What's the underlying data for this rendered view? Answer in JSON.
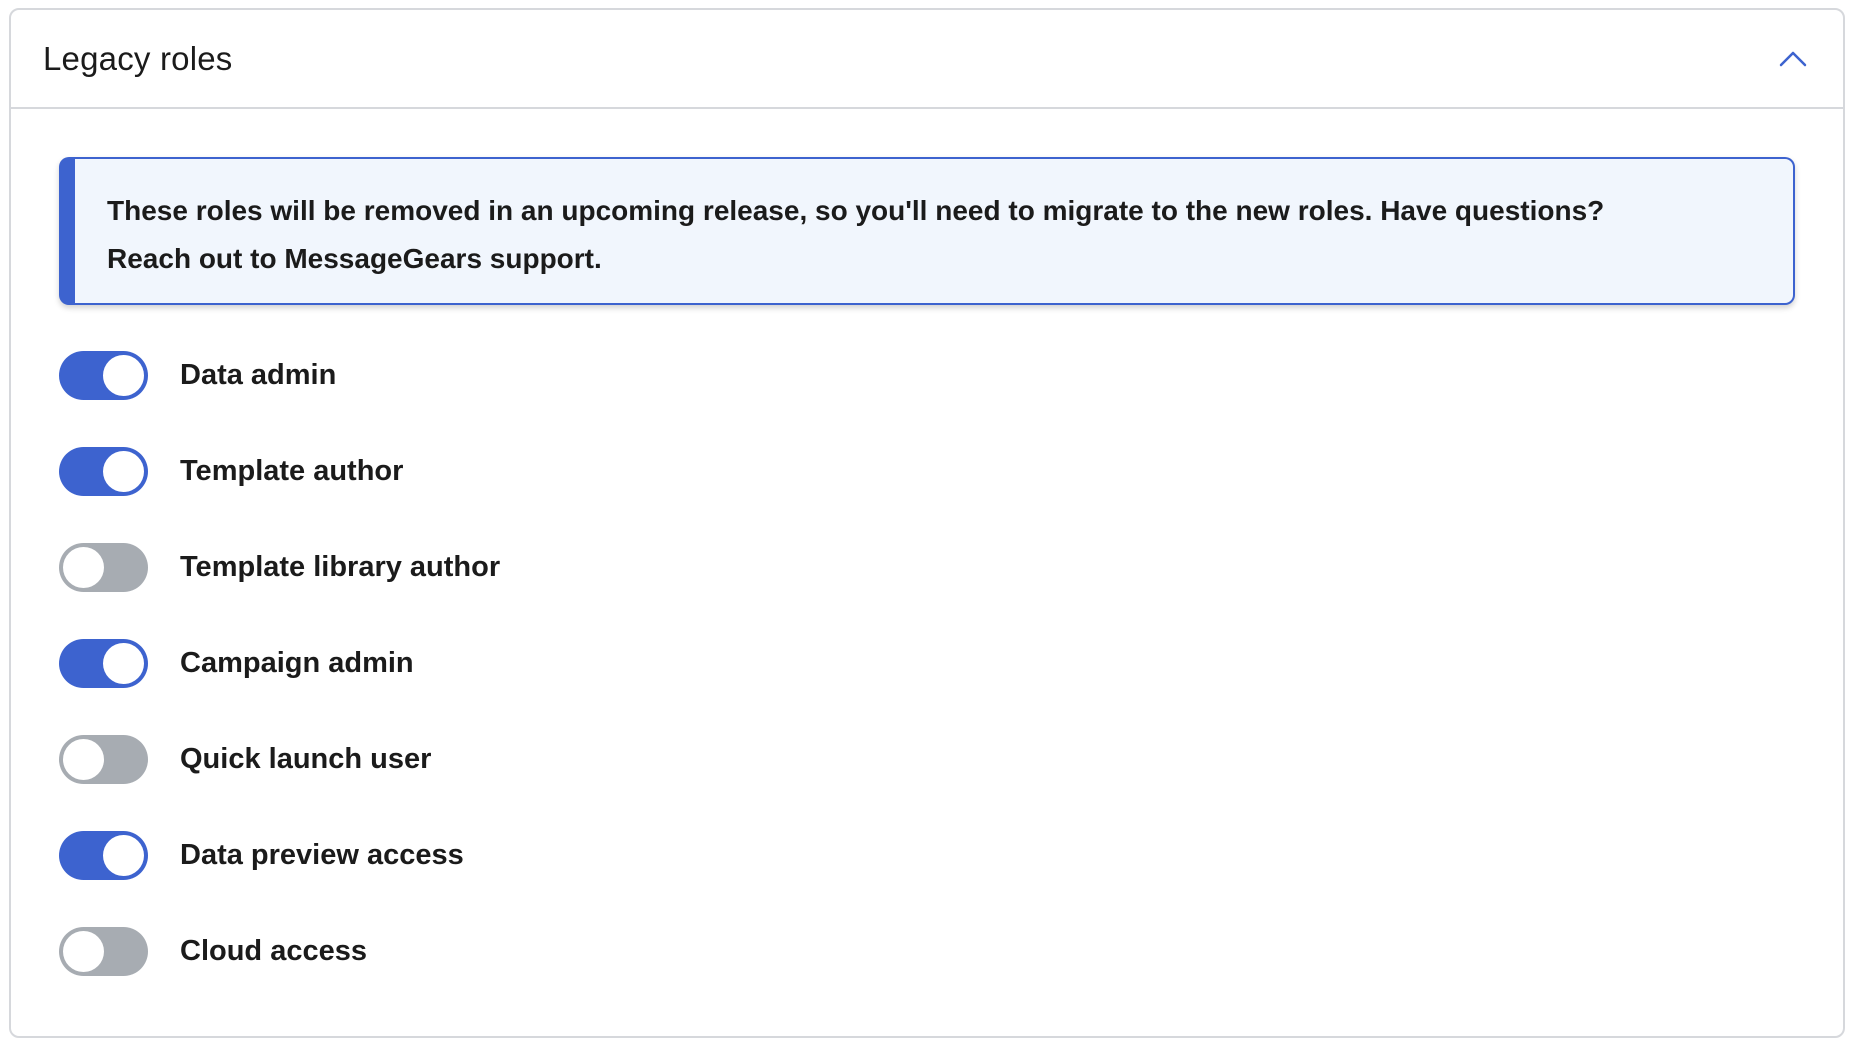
{
  "panel": {
    "title": "Legacy roles",
    "collapse_icon": "chevron-up-icon",
    "accent_color": "#3d63cf"
  },
  "notice": {
    "line1": "These roles will be removed in an upcoming release, so you'll need to migrate to the new roles. Have questions?",
    "line2": "Reach out to MessageGears support."
  },
  "roles": [
    {
      "label": "Data admin",
      "enabled": true
    },
    {
      "label": "Template author",
      "enabled": true
    },
    {
      "label": "Template library author",
      "enabled": false
    },
    {
      "label": "Campaign admin",
      "enabled": true
    },
    {
      "label": "Quick launch user",
      "enabled": false
    },
    {
      "label": "Data preview access",
      "enabled": true
    },
    {
      "label": "Cloud access",
      "enabled": false
    }
  ]
}
